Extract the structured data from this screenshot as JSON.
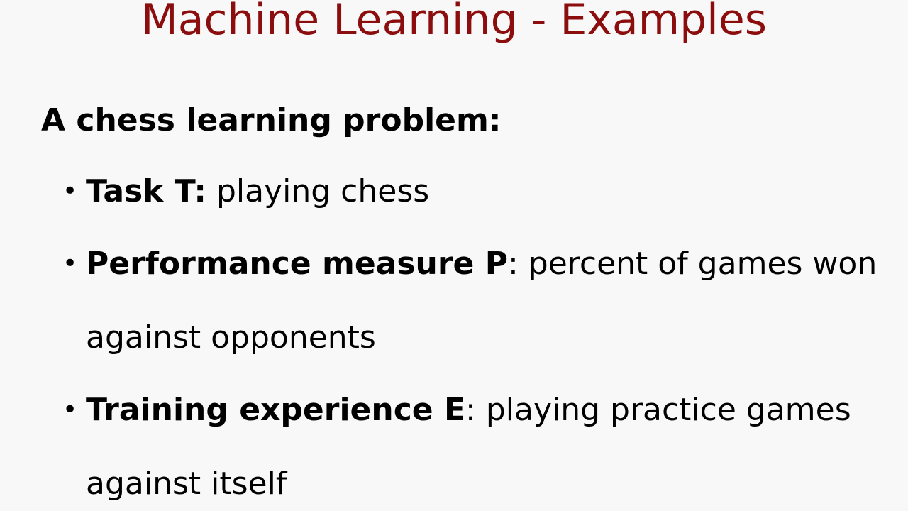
{
  "slide": {
    "title": "Machine Learning - Examples",
    "subtitle": "A chess learning problem:",
    "bullets": [
      {
        "term": "Task T:",
        "text": " playing chess"
      },
      {
        "term": "Performance measure P",
        "text": ": percent of games won against opponents"
      },
      {
        "term": "Training experience E",
        "text": ": playing practice games against itself"
      }
    ],
    "colors": {
      "title": "#8b0d0d",
      "background": "#f8f8f8",
      "text": "#000000"
    }
  }
}
